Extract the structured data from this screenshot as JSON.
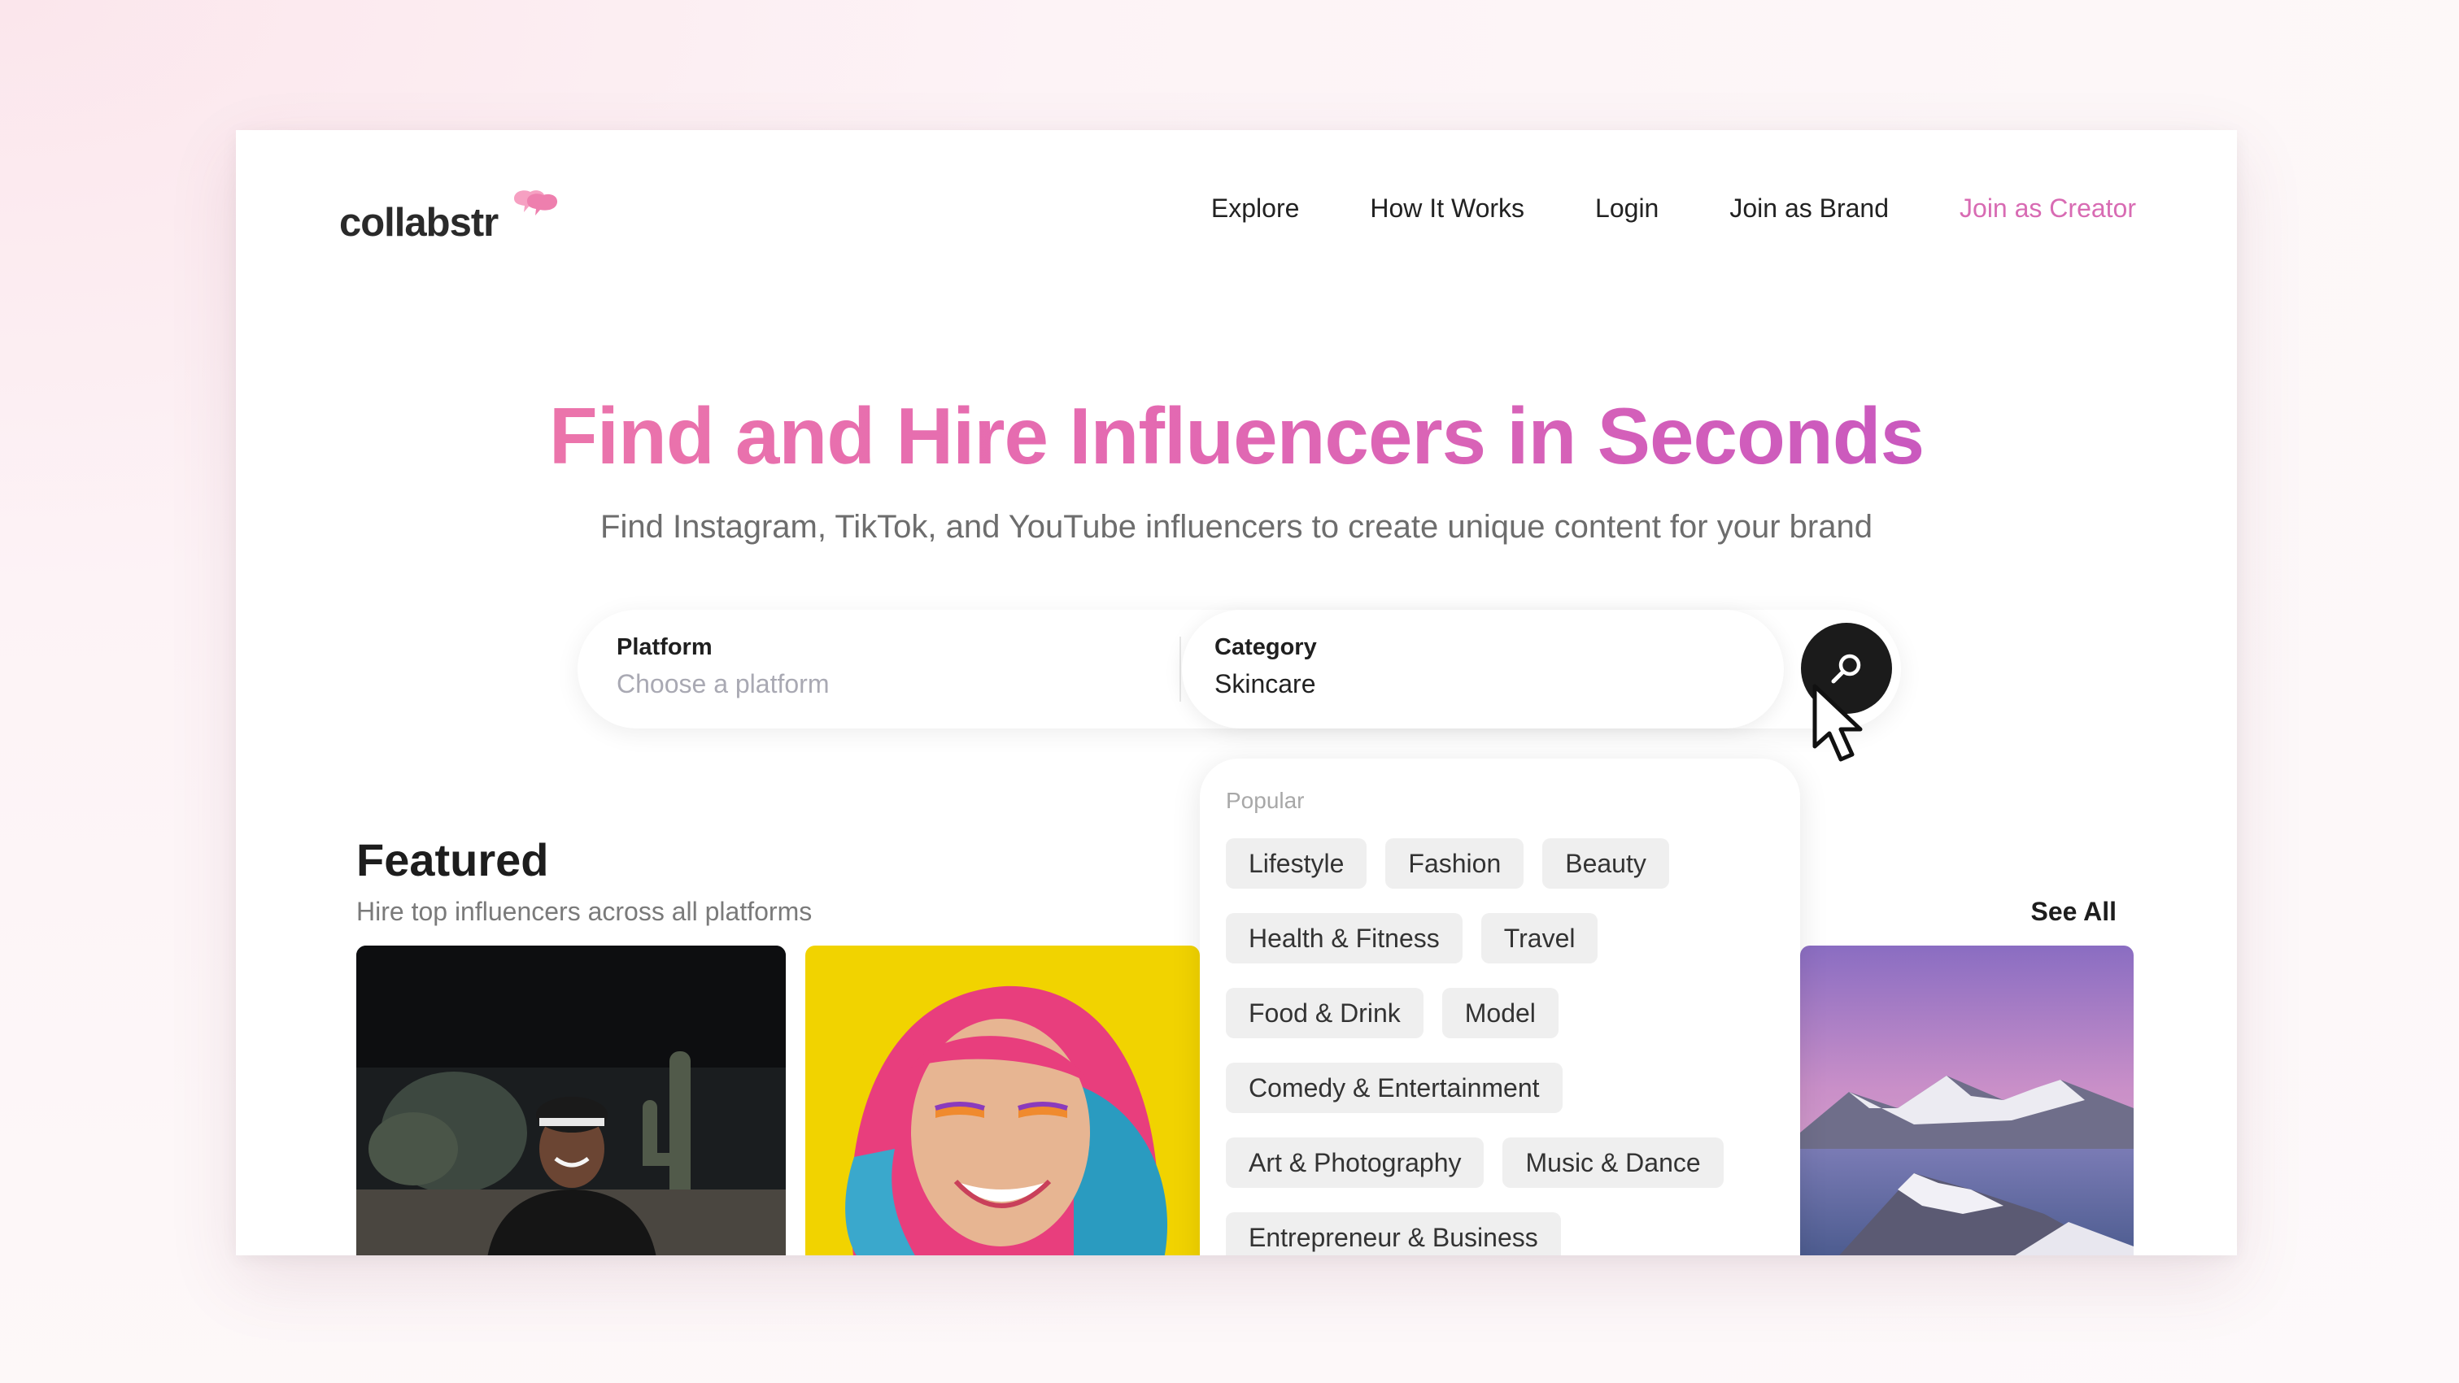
{
  "brand": {
    "name": "collabstr",
    "accent": "#d86bb3"
  },
  "nav": {
    "explore": "Explore",
    "how_it_works": "How It Works",
    "login": "Login",
    "join_brand": "Join as Brand",
    "join_creator": "Join as Creator"
  },
  "hero": {
    "title": "Find and Hire Influencers in Seconds",
    "subtitle": "Find Instagram, TikTok, and YouTube influencers to create unique content for your brand"
  },
  "search": {
    "platform_label": "Platform",
    "platform_placeholder": "Choose a platform",
    "category_label": "Category",
    "category_value": "Skincare",
    "button_icon": "search-icon"
  },
  "dropdown": {
    "heading": "Popular",
    "rows": [
      [
        "Lifestyle",
        "Fashion",
        "Beauty"
      ],
      [
        "Health & Fitness",
        "Travel"
      ],
      [
        "Food & Drink",
        "Model"
      ],
      [
        "Comedy & Entertainment"
      ],
      [
        "Art & Photography",
        "Music & Dance"
      ],
      [
        "Entrepreneur & Business"
      ]
    ]
  },
  "featured": {
    "title": "Featured",
    "subtitle": "Hire top influencers across all platforms",
    "see_all": "See All"
  }
}
